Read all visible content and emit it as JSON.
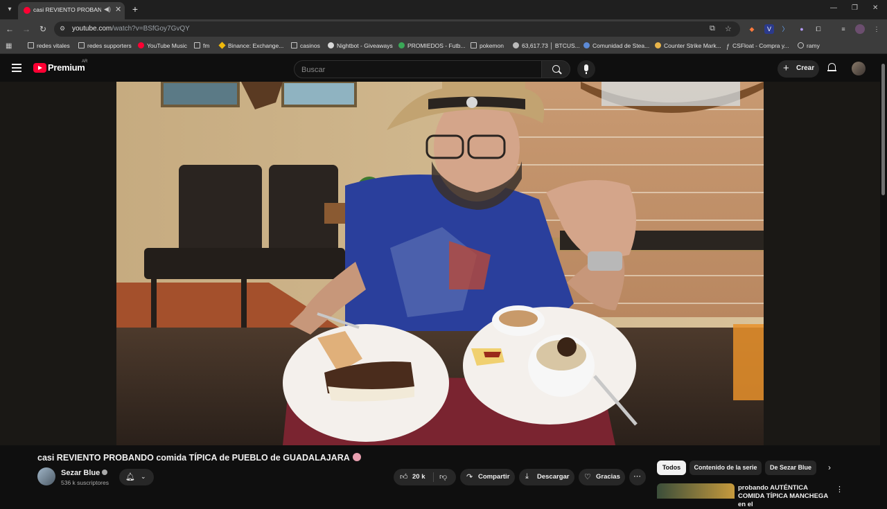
{
  "browser": {
    "tab": {
      "title": "casi REVIENTO PROBANDO"
    },
    "url": {
      "host": "youtube.com",
      "path": "/watch?v=BSfGoy7GvQY"
    },
    "bookmarks": [
      {
        "label": "redes vitales",
        "icon": "folder-icon"
      },
      {
        "label": "redes supporters",
        "icon": "folder-icon"
      },
      {
        "label": "YouTube Music",
        "icon": "youtube-music-icon"
      },
      {
        "label": "fm",
        "icon": "folder-icon"
      },
      {
        "label": "Binance: Exchange...",
        "icon": "binance-icon"
      },
      {
        "label": "casinos",
        "icon": "folder-icon"
      },
      {
        "label": "Nightbot - Giveaways",
        "icon": "nightbot-icon"
      },
      {
        "label": "PROMIEDOS - Futb...",
        "icon": "promiedos-icon"
      },
      {
        "label": "pokemon",
        "icon": "folder-icon"
      },
      {
        "label": "63,617.73 │ BTCUS...",
        "icon": "tradingview-icon"
      },
      {
        "label": "Comunidad de Stea...",
        "icon": "steam-icon"
      },
      {
        "label": "Counter Strike Mark...",
        "icon": "csmarket-icon"
      },
      {
        "label": "CSFloat - Compra y...",
        "icon": "csfloat-icon"
      },
      {
        "label": "ramy",
        "icon": "globe-icon"
      }
    ]
  },
  "youtube": {
    "logo_text": "Premium",
    "region": "AR",
    "search_placeholder": "Buscar",
    "create_label": "Crear"
  },
  "video": {
    "title": "casi REVIENTO PROBANDO comida TÍPICA de PUEBLO de GUADALAJARA",
    "channel": {
      "name": "Sezar Blue",
      "subscribers": "536 k suscriptores"
    },
    "likes": "20 k",
    "actions": {
      "share": "Compartir",
      "download": "Descargar",
      "thanks": "Gracias"
    }
  },
  "sidebar": {
    "chips": [
      "Todos",
      "Contenido de la serie",
      "De Sezar Blue"
    ],
    "recommendation": {
      "title": "probando AUTÉNTICA COMIDA TÍPICA MANCHEGA en el"
    }
  },
  "colors": {
    "brand": "#ff0033",
    "background": "#0f0f0f",
    "pill": "#272727"
  }
}
